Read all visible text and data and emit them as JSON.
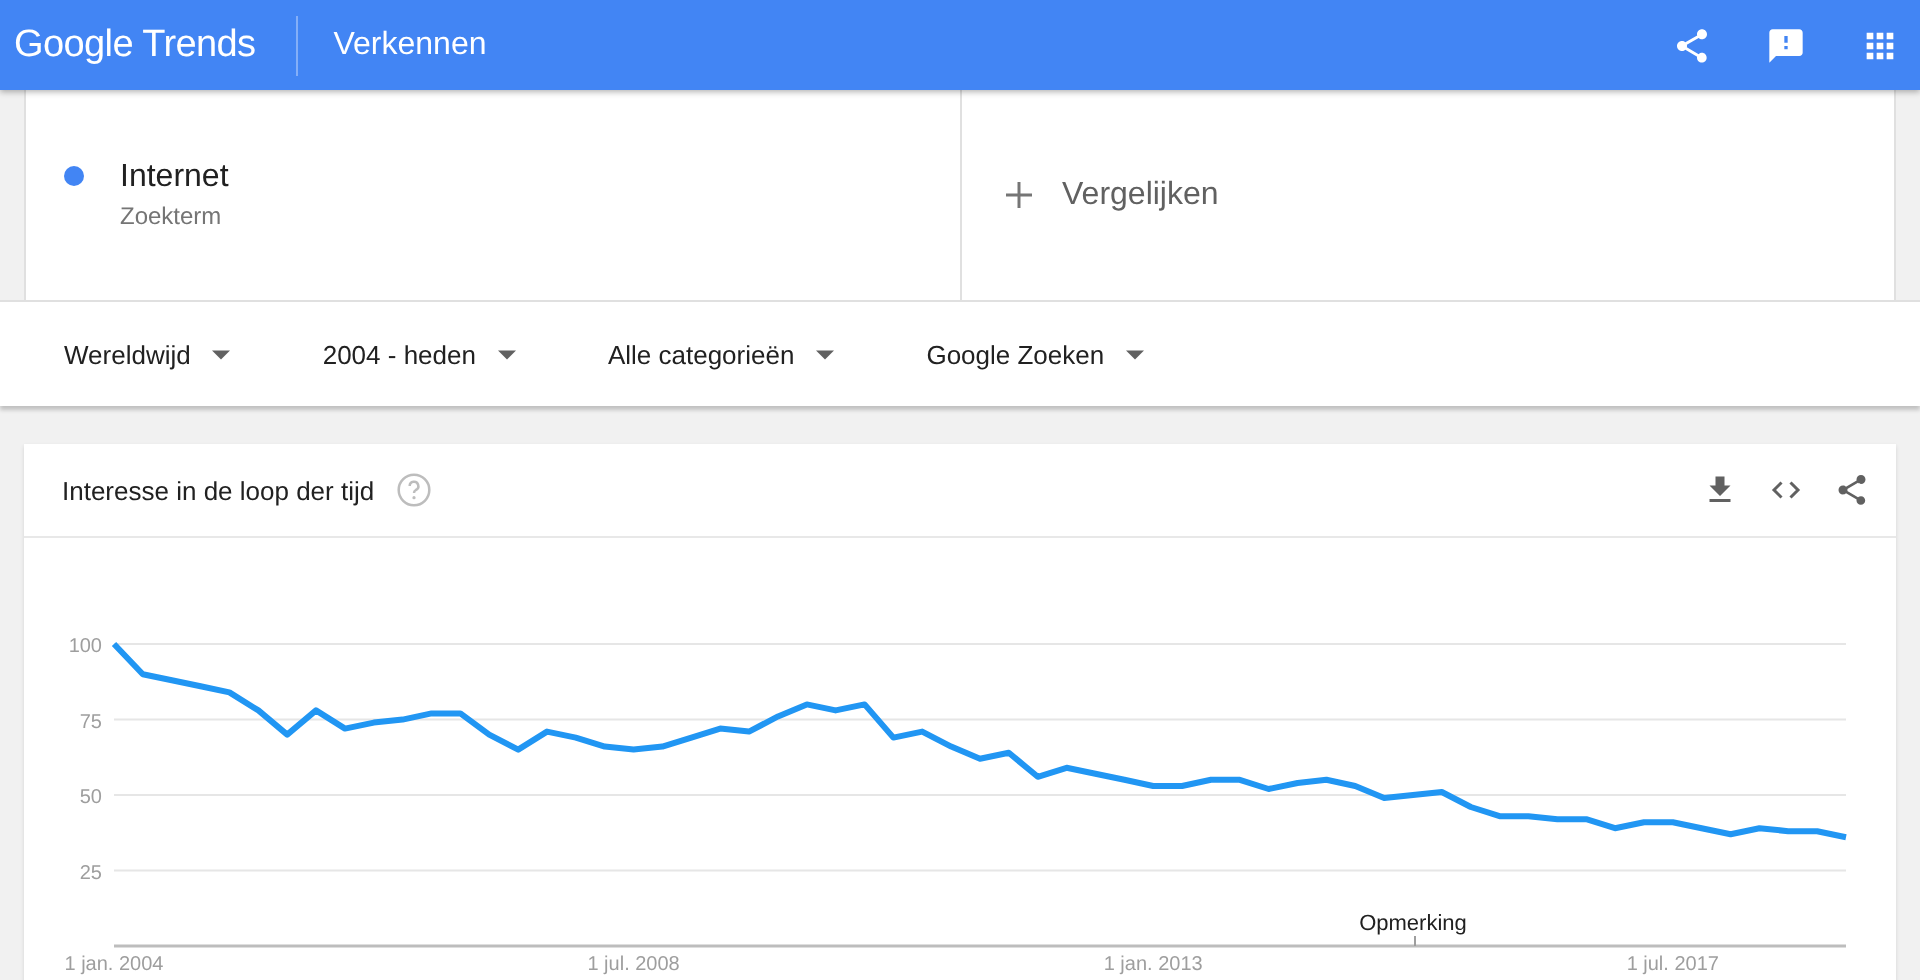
{
  "header": {
    "logo": "Google Trends",
    "title": "Verkennen"
  },
  "terms": [
    {
      "name": "Internet",
      "type": "Zoekterm",
      "color": "#4285f4"
    }
  ],
  "compare": {
    "label": "Vergelijken"
  },
  "filters": [
    {
      "label": "Wereldwijd"
    },
    {
      "label": "2004 - heden"
    },
    {
      "label": "Alle categorieën"
    },
    {
      "label": "Google Zoeken"
    }
  ],
  "interest_card": {
    "title": "Interesse in de loop der tijd",
    "chart_data": {
      "type": "line",
      "grid": true,
      "ylim": [
        0,
        100
      ],
      "yticks": [
        25,
        50,
        75,
        100
      ],
      "categories": [
        "1 jan. 2004",
        null,
        null,
        null,
        null,
        null,
        null,
        null,
        null,
        null,
        null,
        null,
        null,
        null,
        null,
        null,
        null,
        null,
        "1 jul. 2008",
        null,
        null,
        null,
        null,
        null,
        null,
        null,
        null,
        null,
        null,
        null,
        null,
        null,
        null,
        null,
        null,
        null,
        "1 jan. 2013",
        null,
        null,
        null,
        null,
        null,
        null,
        null,
        null,
        null,
        null,
        null,
        null,
        null,
        null,
        null,
        null,
        null,
        "1 jul. 2017",
        null,
        null,
        null,
        null,
        null,
        null
      ],
      "series": [
        {
          "color": "#2196f3",
          "values": [
            100,
            90,
            88,
            86,
            84,
            78,
            70,
            78,
            72,
            74,
            75,
            77,
            77,
            70,
            65,
            71,
            69,
            66,
            65,
            66,
            69,
            72,
            71,
            76,
            80,
            78,
            80,
            69,
            71,
            66,
            62,
            64,
            56,
            59,
            57,
            55,
            53,
            53,
            55,
            55,
            52,
            54,
            55,
            53,
            49,
            50,
            51,
            46,
            43,
            43,
            42,
            42,
            39,
            41,
            41,
            39,
            37,
            39,
            38,
            38,
            36
          ]
        }
      ],
      "annotations": [
        "Opmerking"
      ]
    }
  }
}
